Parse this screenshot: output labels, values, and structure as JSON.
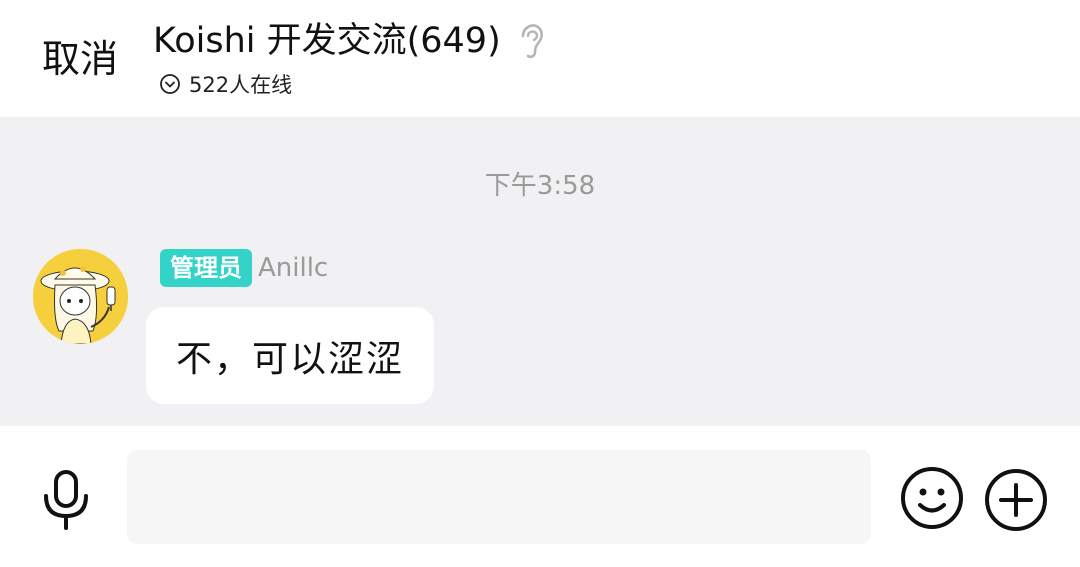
{
  "header": {
    "cancel_label": "取消",
    "title": "Koishi 开发交流(649)",
    "online_status": "522人在线",
    "icons": {
      "ear": "ear-icon",
      "expand": "chevron-down-circle-icon"
    }
  },
  "chat": {
    "timestamp": "下午3:58",
    "messages": [
      {
        "role_badge": "管理员",
        "sender": "Anillc",
        "text": "不，可以涩涩",
        "avatar": "anime-girl-avatar"
      }
    ]
  },
  "input_bar": {
    "placeholder": "",
    "icons": {
      "mic": "microphone-icon",
      "emoji": "emoji-icon",
      "plus": "plus-icon"
    }
  },
  "colors": {
    "badge": "#33d3c8",
    "chat_bg": "#f1f1f3",
    "timestamp": "#9a9a9a",
    "avatar_bg": "#f6cf3d"
  }
}
